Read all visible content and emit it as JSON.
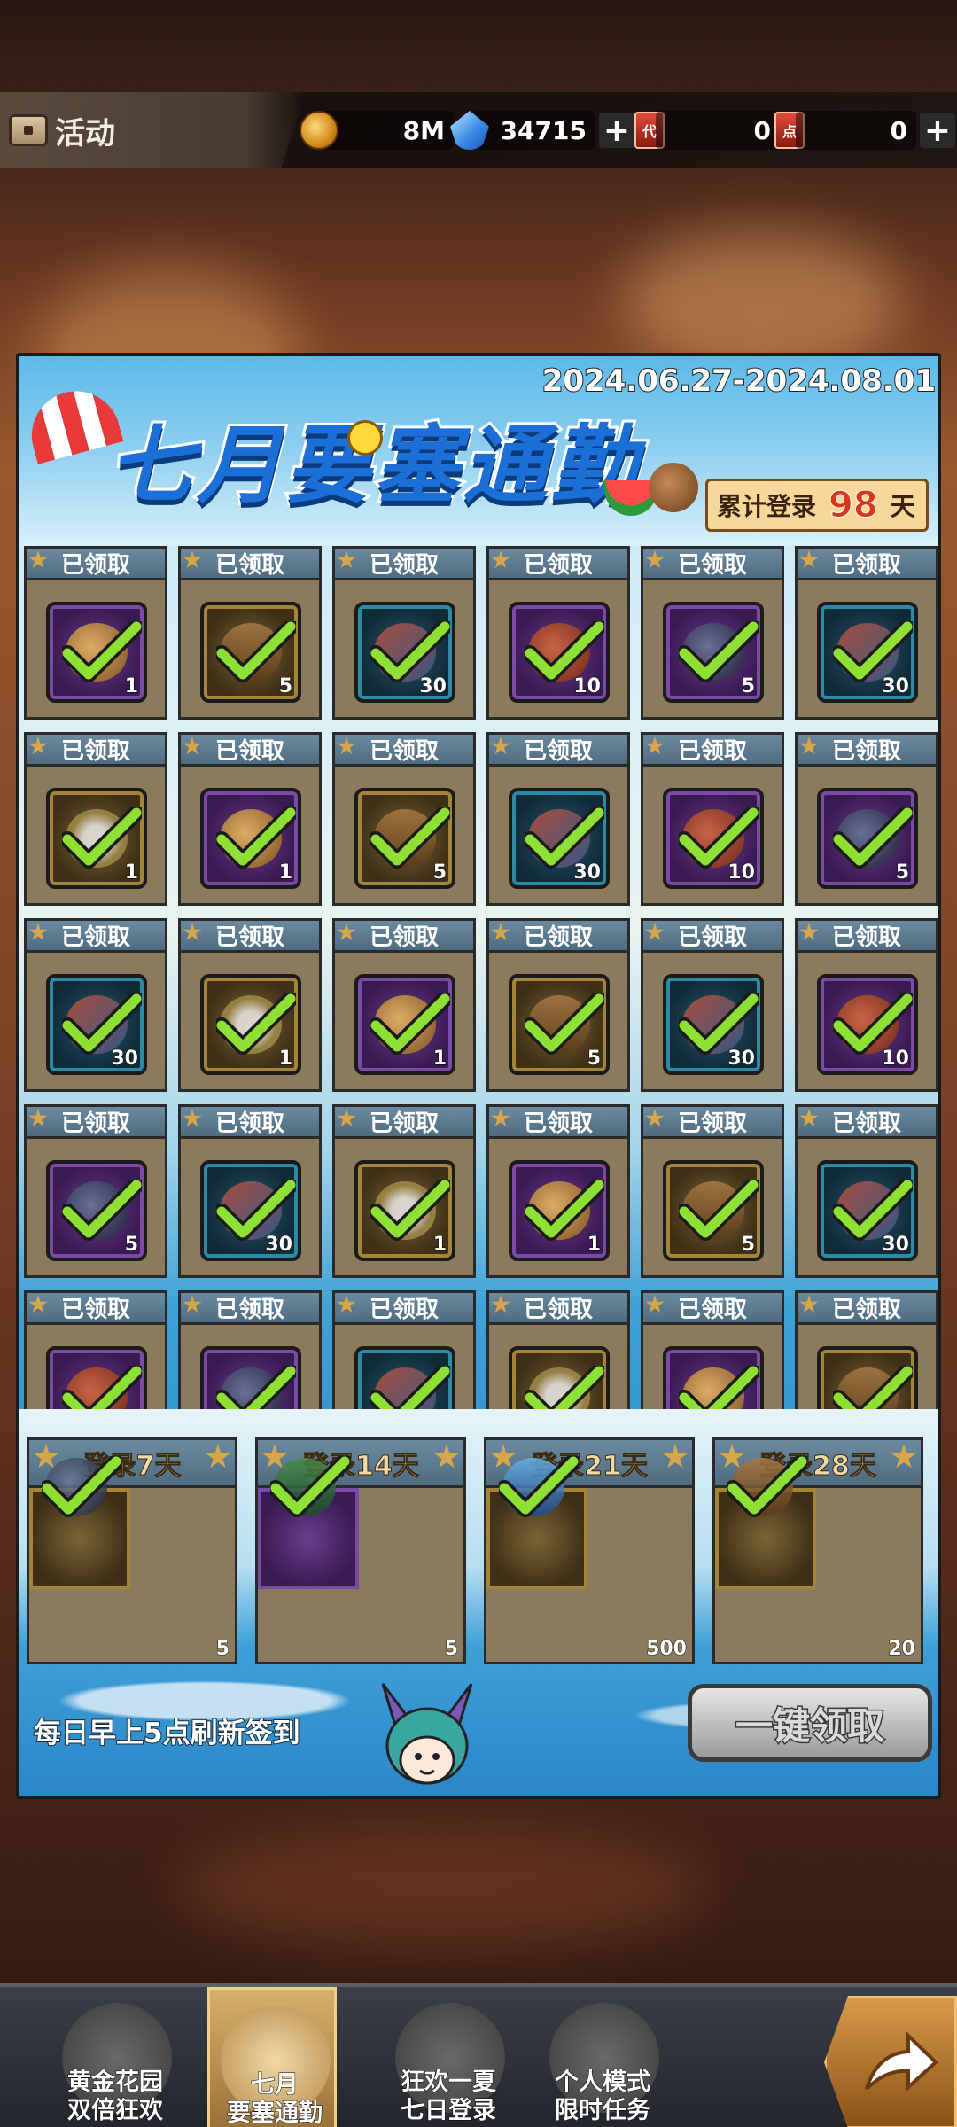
{
  "topbar": {
    "section_label": "活动",
    "gold": "8M",
    "gems": "34715",
    "ticket_red": "0",
    "ticket_card": "0",
    "ticket_red_glyph": "代",
    "ticket_card_glyph": "点"
  },
  "event": {
    "title": "七月要塞通勤",
    "dates": "2024.06.27-2024.08.01",
    "cumulative_label": "累计登录",
    "cumulative_days": "98",
    "cumulative_unit": "天"
  },
  "daily_rewards": [
    {
      "status": "已领取",
      "item": "coins",
      "rarity": "purple",
      "qty": "1"
    },
    {
      "status": "已领取",
      "item": "jar",
      "rarity": "gold",
      "qty": "5"
    },
    {
      "status": "已领取",
      "item": "fish",
      "rarity": "blue",
      "qty": "30"
    },
    {
      "status": "已领取",
      "item": "meat",
      "rarity": "purple",
      "qty": "10"
    },
    {
      "status": "已领取",
      "item": "ore",
      "rarity": "purple",
      "qty": "5"
    },
    {
      "status": "已领取",
      "item": "fish",
      "rarity": "blue",
      "qty": "30"
    },
    {
      "status": "已领取",
      "item": "wings",
      "rarity": "gold",
      "qty": "1"
    },
    {
      "status": "已领取",
      "item": "coins",
      "rarity": "purple",
      "qty": "1"
    },
    {
      "status": "已领取",
      "item": "jar",
      "rarity": "gold",
      "qty": "5"
    },
    {
      "status": "已领取",
      "item": "fish",
      "rarity": "blue",
      "qty": "30"
    },
    {
      "status": "已领取",
      "item": "meat",
      "rarity": "purple",
      "qty": "10"
    },
    {
      "status": "已领取",
      "item": "ore",
      "rarity": "purple",
      "qty": "5"
    },
    {
      "status": "已领取",
      "item": "fish",
      "rarity": "blue",
      "qty": "30"
    },
    {
      "status": "已领取",
      "item": "wings",
      "rarity": "gold",
      "qty": "1"
    },
    {
      "status": "已领取",
      "item": "coins",
      "rarity": "purple",
      "qty": "1"
    },
    {
      "status": "已领取",
      "item": "jar",
      "rarity": "gold",
      "qty": "5"
    },
    {
      "status": "已领取",
      "item": "fish",
      "rarity": "blue",
      "qty": "30"
    },
    {
      "status": "已领取",
      "item": "meat",
      "rarity": "purple",
      "qty": "10"
    },
    {
      "status": "已领取",
      "item": "ore",
      "rarity": "purple",
      "qty": "5"
    },
    {
      "status": "已领取",
      "item": "fish",
      "rarity": "blue",
      "qty": "30"
    },
    {
      "status": "已领取",
      "item": "wings",
      "rarity": "gold",
      "qty": "1"
    },
    {
      "status": "已领取",
      "item": "coins",
      "rarity": "purple",
      "qty": "1"
    },
    {
      "status": "已领取",
      "item": "jar",
      "rarity": "gold",
      "qty": "5"
    },
    {
      "status": "已领取",
      "item": "fish",
      "rarity": "blue",
      "qty": "30"
    },
    {
      "status": "已领取",
      "item": "meat",
      "rarity": "purple",
      "qty": ""
    },
    {
      "status": "已领取",
      "item": "ore",
      "rarity": "purple",
      "qty": ""
    },
    {
      "status": "已领取",
      "item": "fish",
      "rarity": "blue",
      "qty": ""
    },
    {
      "status": "已领取",
      "item": "wings",
      "rarity": "gold",
      "qty": ""
    },
    {
      "status": "已领取",
      "item": "coins",
      "rarity": "purple",
      "qty": ""
    },
    {
      "status": "已领取",
      "item": "jar",
      "rarity": "gold",
      "qty": ""
    }
  ],
  "milestones": [
    {
      "label": "登录7天",
      "item": "ore",
      "rarity": "gold",
      "qty": "5"
    },
    {
      "label": "登录14天",
      "item": "card",
      "rarity": "purple",
      "qty": "5"
    },
    {
      "label": "登录21天",
      "item": "book",
      "rarity": "gold",
      "qty": "500"
    },
    {
      "label": "登录28天",
      "item": "jar",
      "rarity": "gold",
      "qty": "20"
    }
  ],
  "footer": {
    "refresh_note": "每日早上5点刷新签到",
    "claim_all_label": "一键领取"
  },
  "bottom_nav": [
    {
      "line1": "黄金花园",
      "line2": "双倍狂欢",
      "active": false
    },
    {
      "line1": "七月",
      "line2": "要塞通勤",
      "active": true
    },
    {
      "line1": "狂欢一夏",
      "line2": "七日登录",
      "active": false
    },
    {
      "line1": "个人模式",
      "line2": "限时任务",
      "active": false
    }
  ],
  "colors": {
    "claimed_check": "#8fe034",
    "panel_header": "#5a7a90",
    "accent_days": "#d8381a"
  }
}
